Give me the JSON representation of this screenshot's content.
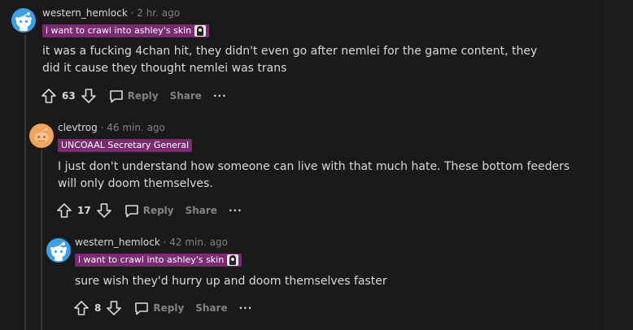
{
  "colors": {
    "background": "#1a1a1b",
    "text": "#d7dadc",
    "muted": "#818384",
    "flair_bg": "#7a2b71",
    "thread_line": "#343536"
  },
  "comments": [
    {
      "author": "western_hemlock",
      "separator": "·",
      "time": "2 hr. ago",
      "flair": "i want to crawl into ashley's skin",
      "body": "it was a fucking 4chan hit, they didn't even go after nemlei for the game content, they did it cause they thought nemlei was trans",
      "votes": "63",
      "reply_label": "Reply",
      "share_label": "Share",
      "more_label": "···",
      "avatar_icon": "snoo-avatar-icon"
    },
    {
      "author": "clevtrog",
      "separator": "·",
      "time": "46 min. ago",
      "flair": "UNCOAAL Secretary General",
      "body": "I just don't understand how someone can live with that much hate. These bottom feeders will only doom themselves.",
      "votes": "17",
      "reply_label": "Reply",
      "share_label": "Share",
      "more_label": "···",
      "avatar_icon": "orange-avatar-icon"
    },
    {
      "author": "western_hemlock",
      "separator": "·",
      "time": "42 min. ago",
      "flair": "i want to crawl into ashley's skin",
      "body": "sure wish they'd hurry up and doom themselves faster",
      "votes": "8",
      "reply_label": "Reply",
      "share_label": "Share",
      "more_label": "···",
      "avatar_icon": "snoo-avatar-icon"
    }
  ]
}
